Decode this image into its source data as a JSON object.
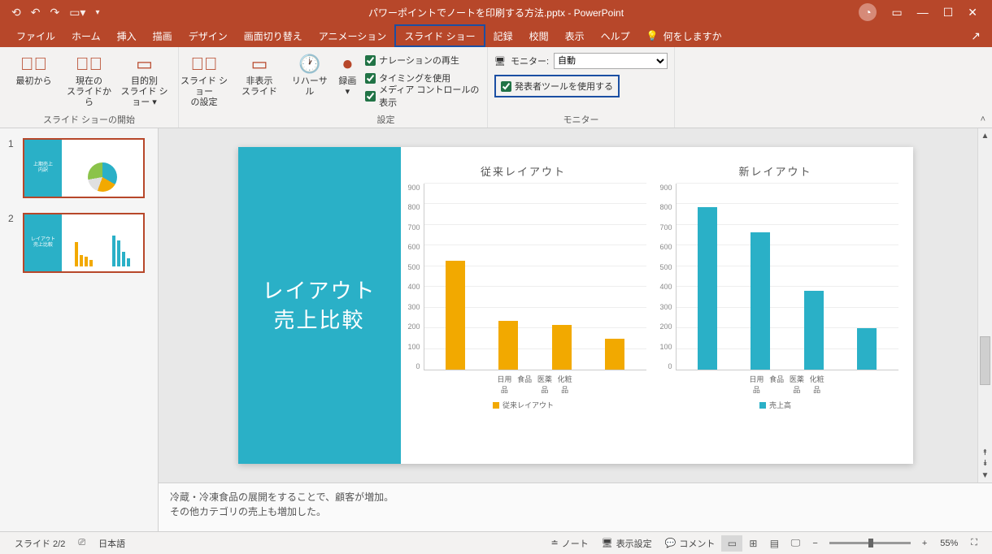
{
  "title": "パワーポイントでノートを印刷する方法.pptx  -  PowerPoint",
  "tabs": [
    "ファイル",
    "ホーム",
    "挿入",
    "描画",
    "デザイン",
    "画面切り替え",
    "アニメーション",
    "スライド ショー",
    "記録",
    "校閲",
    "表示",
    "ヘルプ"
  ],
  "active_tab": "スライド ショー",
  "tell_me": "何をしますか",
  "ribbon": {
    "group1": {
      "label": "スライド ショーの開始",
      "btn1": "最初から",
      "btn2_l1": "現在の",
      "btn2_l2": "スライドから",
      "btn3_l1": "目的別",
      "btn3_l2": "スライド ショー ▾"
    },
    "group2": {
      "btn1_l1": "スライド ショー",
      "btn1_l2": "の設定",
      "btn2_l1": "非表示",
      "btn2_l2": "スライド"
    },
    "group3": {
      "label": "設定",
      "btn1": "リハーサル",
      "btn2_l1": "録画",
      "btn2_l2": "▾",
      "chk1": "ナレーションの再生",
      "chk2": "タイミングを使用",
      "chk3": "メディア コントロールの表示"
    },
    "group4": {
      "label": "モニター",
      "monitor_label": "モニター:",
      "monitor_value": "自動",
      "presenter_chk": "発表者ツールを使用する"
    }
  },
  "thumbnails": {
    "t1_num": "1",
    "t1_title": "上期売上\n内訳",
    "t2_num": "2",
    "t2_title": "レイアウト\n売上比較"
  },
  "slide": {
    "title": "レイアウト\n売上比較"
  },
  "chart_data": [
    {
      "type": "bar",
      "title": "従来レイアウト",
      "categories": [
        "日用品",
        "食品",
        "医薬品",
        "化粧品"
      ],
      "values": [
        525,
        235,
        215,
        150
      ],
      "ylim": [
        0,
        900
      ],
      "ystep": 100,
      "legend": "従来レイアウト",
      "color": "#f2a900"
    },
    {
      "type": "bar",
      "title": "新レイアウト",
      "categories": [
        "日用品",
        "食品",
        "医薬品",
        "化粧品"
      ],
      "values": [
        785,
        665,
        380,
        200
      ],
      "ylim": [
        0,
        900
      ],
      "ystep": 100,
      "legend": "売上高",
      "color": "#2ab0c7"
    }
  ],
  "notes": {
    "l1": "冷蔵・冷凍食品の展開をすることで、顧客が増加。",
    "l2": "その他カテゴリの売上も増加した。"
  },
  "status": {
    "slide": "スライド 2/2",
    "lang": "日本語",
    "notes_btn": "ノート",
    "display_btn": "表示設定",
    "comments_btn": "コメント",
    "zoom": "55%"
  }
}
